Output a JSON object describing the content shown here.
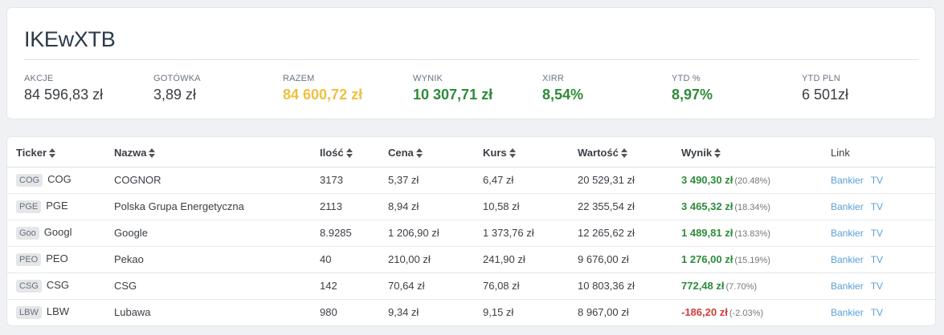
{
  "portfolio": {
    "title": "IKEwXTB",
    "stats": [
      {
        "label": "AKCJE",
        "value": "84 596,83 zł",
        "style": "normal"
      },
      {
        "label": "GOTÓWKA",
        "value": "3,89 zł",
        "style": "normal"
      },
      {
        "label": "RAZEM",
        "value": "84 600,72 zł",
        "style": "yellow"
      },
      {
        "label": "WYNIK",
        "value": "10 307,71 zł",
        "style": "green"
      },
      {
        "label": "XIRR",
        "value": "8,54%",
        "style": "green"
      },
      {
        "label": "YTD %",
        "value": "8,97%",
        "style": "green"
      },
      {
        "label": "YTD PLN",
        "value": "6 501zł",
        "style": "normal"
      }
    ]
  },
  "table": {
    "headers": {
      "ticker": "Ticker",
      "nazwa": "Nazwa",
      "ilosc": "Ilość",
      "cena": "Cena",
      "kurs": "Kurs",
      "wartosc": "Wartość",
      "wynik": "Wynik",
      "link": "Link"
    },
    "rows": [
      {
        "badge": "COG",
        "ticker": "COG",
        "nazwa": "COGNOR",
        "ilosc": "3173",
        "cena": "5,37 zł",
        "kurs": "6,47 zł",
        "wartosc": "20 529,31 zł",
        "wynik": "3 490,30 zł",
        "pct": "(20.48%)",
        "positive": true,
        "link1": "Bankier",
        "link2": "TV"
      },
      {
        "badge": "PGE",
        "ticker": "PGE",
        "nazwa": "Polska Grupa Energetyczna",
        "ilosc": "2113",
        "cena": "8,94 zł",
        "kurs": "10,58 zł",
        "wartosc": "22 355,54 zł",
        "wynik": "3 465,32 zł",
        "pct": "(18.34%)",
        "positive": true,
        "link1": "Bankier",
        "link2": "TV"
      },
      {
        "badge": "Goo",
        "ticker": "Googl",
        "nazwa": "Google",
        "ilosc": "8.9285",
        "cena": "1 206,90 zł",
        "kurs": "1 373,76 zł",
        "wartosc": "12 265,62 zł",
        "wynik": "1 489,81 zł",
        "pct": "(13.83%)",
        "positive": true,
        "link1": "Bankier",
        "link2": "TV"
      },
      {
        "badge": "PEO",
        "ticker": "PEO",
        "nazwa": "Pekao",
        "ilosc": "40",
        "cena": "210,00 zł",
        "kurs": "241,90 zł",
        "wartosc": "9 676,00 zł",
        "wynik": "1 276,00 zł",
        "pct": "(15.19%)",
        "positive": true,
        "link1": "Bankier",
        "link2": "TV"
      },
      {
        "badge": "CSG",
        "ticker": "CSG",
        "nazwa": "CSG",
        "ilosc": "142",
        "cena": "70,64 zł",
        "kurs": "76,08 zł",
        "wartosc": "10 803,36 zł",
        "wynik": "772,48 zł",
        "pct": "(7.70%)",
        "positive": true,
        "link1": "Bankier",
        "link2": "TV"
      },
      {
        "badge": "LBW",
        "ticker": "LBW",
        "nazwa": "Lubawa",
        "ilosc": "980",
        "cena": "9,34 zł",
        "kurs": "9,15 zł",
        "wartosc": "8 967,00 zł",
        "wynik": "-186,20 zł",
        "pct": "(-2.03%)",
        "positive": false,
        "link1": "Bankier",
        "link2": "TV"
      }
    ]
  },
  "colors": {
    "accent_yellow": "#f0c040",
    "gain_green": "#2e8b3a",
    "loss_red": "#d33a3a",
    "link_blue": "#5aa0d8"
  },
  "icons": {
    "sort": "sort-icon"
  }
}
